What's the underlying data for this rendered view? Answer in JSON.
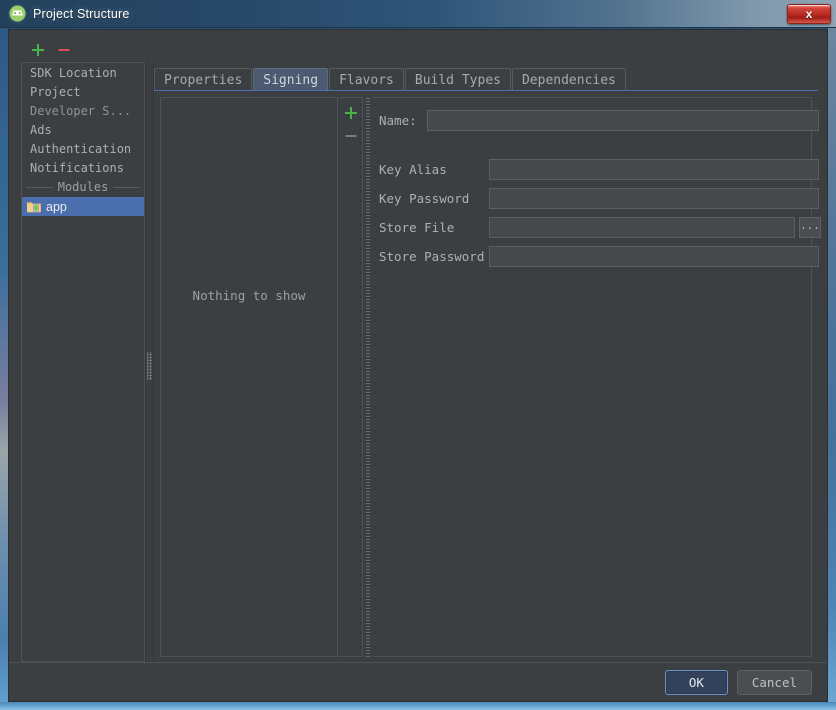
{
  "window": {
    "title": "Project Structure",
    "app_icon": "android-studio-icon",
    "close_label": "x"
  },
  "left_toolbar": {
    "add_label": "+",
    "remove_label": "−"
  },
  "sidebar": {
    "items": [
      {
        "label": "SDK Location",
        "selected": false,
        "style": "normal"
      },
      {
        "label": "Project",
        "selected": false,
        "style": "normal"
      },
      {
        "label": "Developer S...",
        "selected": false,
        "style": "dim"
      },
      {
        "label": "Ads",
        "selected": false,
        "style": "normal"
      },
      {
        "label": "Authentication",
        "selected": false,
        "style": "normal"
      },
      {
        "label": "Notifications",
        "selected": false,
        "style": "normal"
      }
    ],
    "separator_label": "Modules",
    "modules": [
      {
        "label": "app",
        "selected": true,
        "icon": "module-folder-icon"
      }
    ]
  },
  "tabs": [
    {
      "label": "Properties",
      "active": false
    },
    {
      "label": "Signing",
      "active": true
    },
    {
      "label": "Flavors",
      "active": false
    },
    {
      "label": "Build Types",
      "active": false
    },
    {
      "label": "Dependencies",
      "active": false
    }
  ],
  "signing_list": {
    "empty_text": "Nothing to show",
    "add_label": "+",
    "remove_label": "−"
  },
  "form": {
    "name_label": "Name:",
    "name_value": "",
    "fields": [
      {
        "label": "Key Alias",
        "value": "",
        "has_browse": false
      },
      {
        "label": "Key Password",
        "value": "",
        "has_browse": false
      },
      {
        "label": "Store File",
        "value": "",
        "has_browse": true,
        "browse_label": "..."
      },
      {
        "label": "Store Password",
        "value": "",
        "has_browse": false
      }
    ]
  },
  "buttons": {
    "ok": "OK",
    "cancel": "Cancel"
  },
  "colors": {
    "background": "#3c3f41",
    "selection": "#4b6eaf",
    "active_tab": "#4b5a70",
    "add_green": "#4caf50",
    "remove_red": "#d9534f",
    "text": "#a9b1b6",
    "titlebar_start": "#24415c",
    "close_red": "#b82a22"
  }
}
